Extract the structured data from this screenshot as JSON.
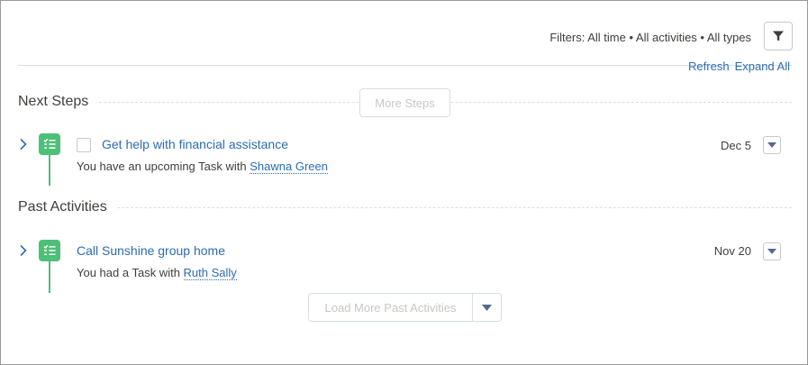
{
  "header": {
    "filters_text": "Filters: All time • All activities • All types",
    "refresh_label": "Refresh",
    "expand_all_label": "Expand All"
  },
  "next_steps": {
    "title": "Next Steps",
    "more_steps_label": "More Steps",
    "items": [
      {
        "title": "Get help with financial assistance",
        "subtitle_prefix": "You have an upcoming Task with ",
        "person": "Shawna Green",
        "date": "Dec 5"
      }
    ]
  },
  "past_activities": {
    "title": "Past Activities",
    "items": [
      {
        "title": "Call Sunshine group home",
        "subtitle_prefix": "You had a Task with ",
        "person": "Ruth Sally",
        "date": "Nov 20"
      }
    ],
    "load_more_label": "Load More Past Activities"
  },
  "icons": {
    "filter": "filter-icon",
    "expand": "chevron-right-icon",
    "task": "task-icon",
    "menu": "chevron-down-icon"
  },
  "colors": {
    "link": "#2b6cb4",
    "task_green": "#4bc076",
    "text": "#3e3e3c",
    "disabled_text": "#c9c7c5"
  }
}
